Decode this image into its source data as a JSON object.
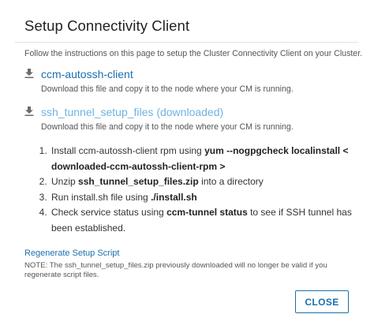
{
  "dialog": {
    "title": "Setup Connectivity Client",
    "intro": "Follow the instructions on this page to setup the Cluster Connectivity Client on your Cluster."
  },
  "downloads": [
    {
      "icon": "download-icon",
      "label": "ccm-autossh-client",
      "state": "not-downloaded",
      "color": "#1b6fae",
      "description": "Download this file and copy it to the node where your CM is running."
    },
    {
      "icon": "download-icon",
      "label": "ssh_tunnel_setup_files (downloaded)",
      "state": "downloaded",
      "color": "#6fb3e0",
      "description": "Download this file and copy it to the node where your CM is running."
    }
  ],
  "steps": [
    {
      "before": "Install ccm-autossh-client rpm using ",
      "bold": "yum --nogpgcheck localinstall < downloaded-ccm-autossh-client-rpm >",
      "after": ""
    },
    {
      "before": "Unzip ",
      "bold": "ssh_tunnel_setup_files.zip",
      "after": " into a directory"
    },
    {
      "before": "Run install.sh file using ",
      "bold": "./install.sh",
      "after": ""
    },
    {
      "before": "Check service status using ",
      "bold": "ccm-tunnel status",
      "after": " to see if SSH tunnel has been established."
    }
  ],
  "regenerate": {
    "label": "Regenerate Setup Script",
    "note": "NOTE: The ssh_tunnel_setup_files.zip previously downloaded will no longer be valid if you regenerate script files."
  },
  "footer": {
    "close_label": "CLOSE"
  },
  "colors": {
    "accent": "#1b6fae",
    "visited_link": "#6fb3e0",
    "icon": "#6b6b6b"
  }
}
